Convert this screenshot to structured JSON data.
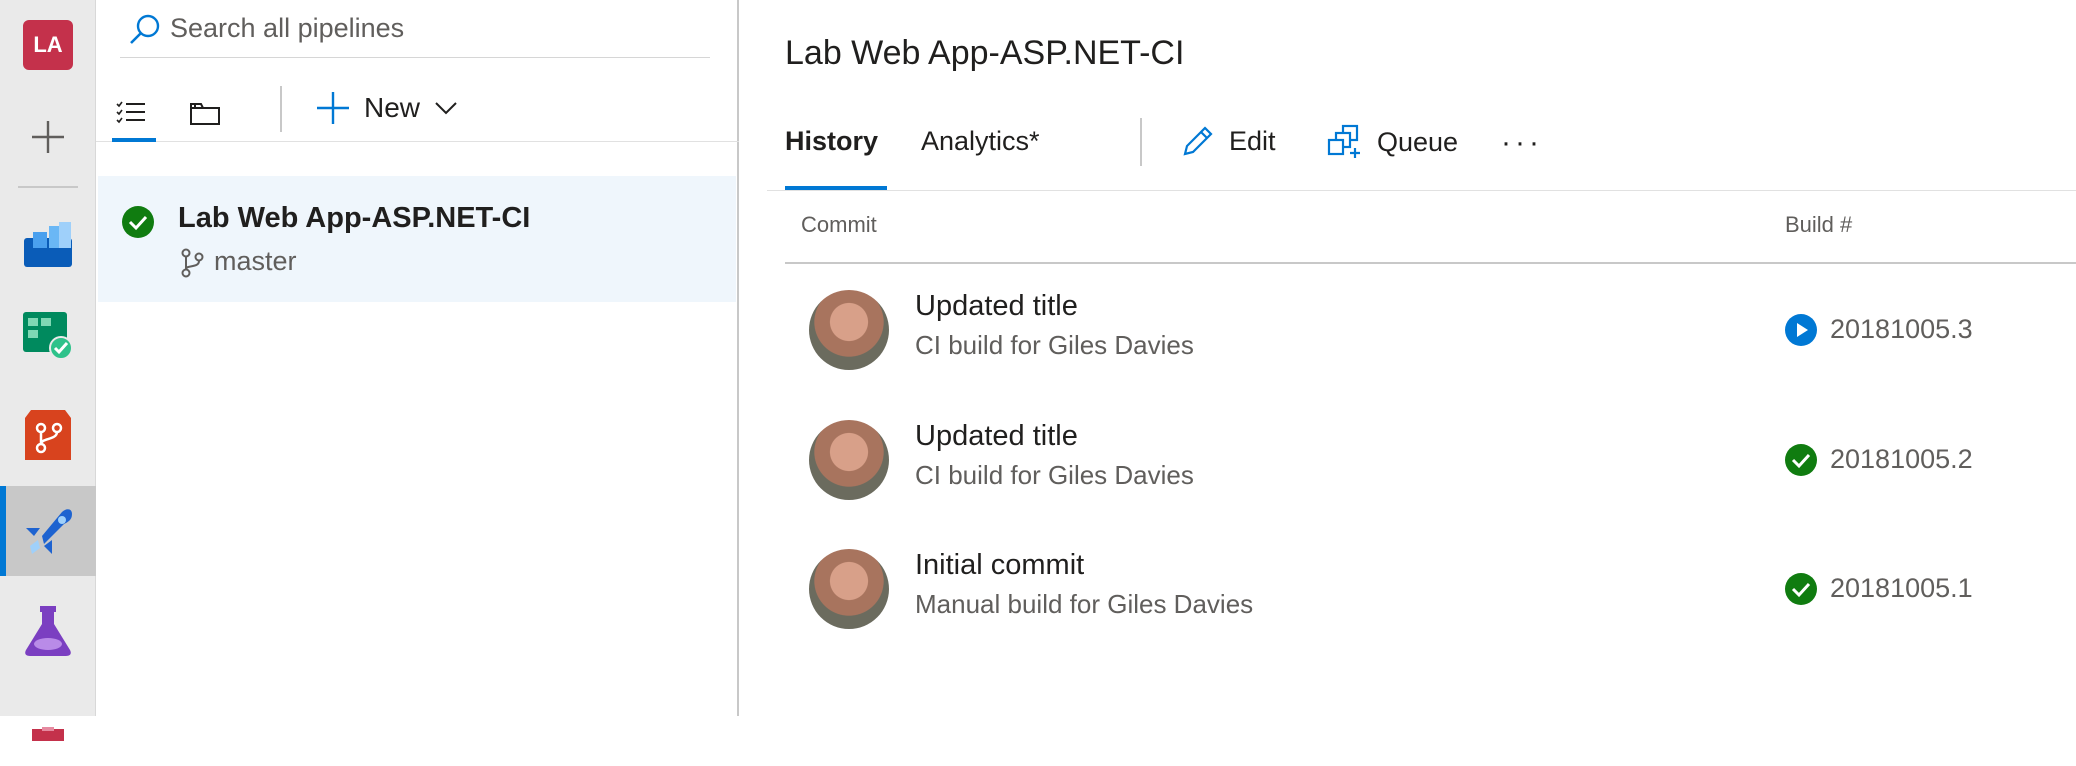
{
  "rail": {
    "org_initials": "LA",
    "items": [
      {
        "name": "overview",
        "color": "#0078d4"
      },
      {
        "name": "boards",
        "color": "#009c6c"
      },
      {
        "name": "repos",
        "color": "#e05b26"
      },
      {
        "name": "pipelines",
        "color": "#0078d4",
        "active": true
      },
      {
        "name": "test-plans",
        "color": "#7b3fc1"
      },
      {
        "name": "artifacts",
        "color": "#c4314b"
      }
    ]
  },
  "panel": {
    "search_placeholder": "Search all pipelines",
    "new_label": "New",
    "pipeline": {
      "name": "Lab Web App-ASP.NET-CI",
      "branch": "master",
      "status": "succeeded"
    }
  },
  "main": {
    "title": "Lab Web App-ASP.NET-CI",
    "tabs": [
      {
        "label": "History",
        "active": true
      },
      {
        "label": "Analytics*",
        "active": false
      }
    ],
    "actions": {
      "edit_label": "Edit",
      "queue_label": "Queue",
      "more_label": "···"
    },
    "columns": {
      "commit": "Commit",
      "build": "Build #"
    },
    "rows": [
      {
        "title": "Updated title",
        "subtitle": "CI build for Giles Davies",
        "build": "20181005.3",
        "status": "running"
      },
      {
        "title": "Updated title",
        "subtitle": "CI build for Giles Davies",
        "build": "20181005.2",
        "status": "succeeded"
      },
      {
        "title": "Initial commit",
        "subtitle": "Manual build for Giles Davies",
        "build": "20181005.1",
        "status": "succeeded"
      }
    ]
  },
  "colors": {
    "accent": "#0078d4",
    "success": "#107c10",
    "selected_bg": "#eff6fc"
  }
}
